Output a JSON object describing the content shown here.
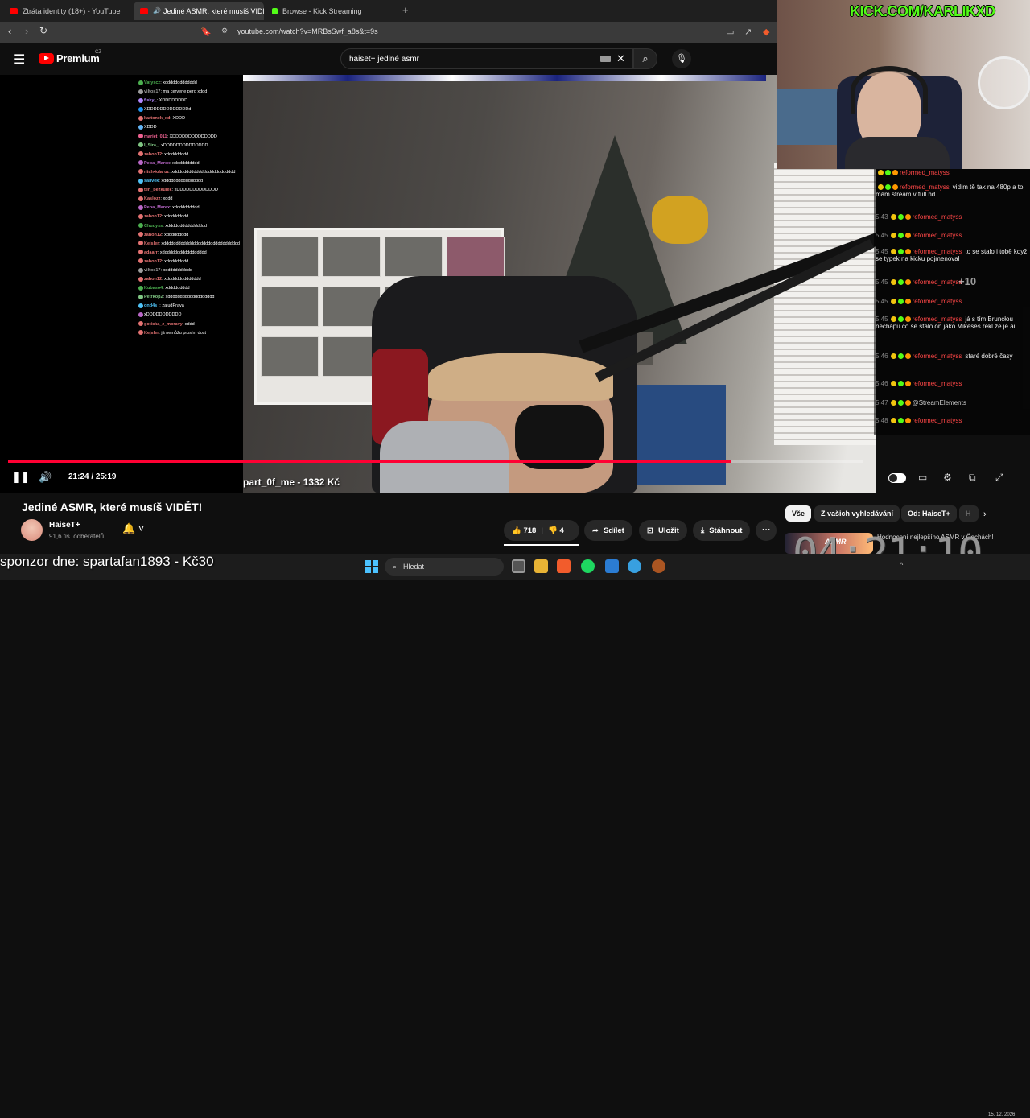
{
  "browser": {
    "tabs": [
      {
        "title": "Ztráta identity (18+) - YouTube",
        "active": false
      },
      {
        "title": "Jediné ASMR, které musíš VIDĚ",
        "active": true
      },
      {
        "title": "Browse - Kick Streaming",
        "active": false
      }
    ],
    "url": "youtube.com/watch?v=MRBsSwf_a8s&t=9s"
  },
  "youtube": {
    "logo": "Premium",
    "region": "CZ",
    "search_value": "haiset+ jediné asmr"
  },
  "overlay": {
    "kick_url": "KICK.COM/KARLIKXD",
    "donor_text": "part_0f_me - 1332 Kč",
    "sponsor": "sponzor dne: spartafan1893 - Kč30",
    "clock": "04:21:10"
  },
  "player": {
    "time": "21:24 / 25:19",
    "progress": 0.845
  },
  "left_chat": [
    {
      "name": "Vatyscz",
      "text": "xddddddddddddd",
      "color": "#4caf50"
    },
    {
      "name": "viltos17",
      "text": "ma cervene pero xddd",
      "color": "#9e9e9e"
    },
    {
      "name": "fisky_",
      "text": "XDDDDDDDD",
      "color": "#b388ff"
    },
    {
      "name": "",
      "text": "XDDDDDDDDDDDDDd",
      "color": "#2196f3"
    },
    {
      "name": "kartonek_xd",
      "text": "XDDD",
      "color": "#e57373"
    },
    {
      "name": "",
      "text": "XDDD",
      "color": "#64b5f6"
    },
    {
      "name": "mariet_011",
      "text": "XDDDDDDDDDDDDDD",
      "color": "#f06292"
    },
    {
      "name": "l_Sira_",
      "text": "xDDDDDDDDDDDDDD",
      "color": "#81c784"
    },
    {
      "name": "zahon12",
      "text": "xddddddddd",
      "color": "#e57373"
    },
    {
      "name": "Pepa_Marex",
      "text": "xdddddddddd",
      "color": "#ba68c8"
    },
    {
      "name": "ritch4olaruz",
      "text": "xddddddddddddddddddddddddd",
      "color": "#e57373"
    },
    {
      "name": "salivek",
      "text": "xdddddddddddddddd",
      "color": "#4fc3f7"
    },
    {
      "name": "ten_bezkulek",
      "text": "xDDDDDDDDDDDDD",
      "color": "#e57373"
    },
    {
      "name": "Kaslozz",
      "text": "xddd",
      "color": "#e57373"
    },
    {
      "name": "Pepa_Marex",
      "text": "xdddddddddd",
      "color": "#ba68c8"
    },
    {
      "name": "zahon12",
      "text": "xddddddddd",
      "color": "#e57373"
    },
    {
      "name": "Chudyss",
      "text": "xdddddddddddddddd",
      "color": "#4caf50"
    },
    {
      "name": "zahon12",
      "text": "xddddddddd",
      "color": "#e57373"
    },
    {
      "name": "Kejsler",
      "text": "xddddddddddddddddddddddddddddddd",
      "color": "#e57373"
    },
    {
      "name": "adaarr",
      "text": "xdddddddddddddddddd",
      "color": "#e57373"
    },
    {
      "name": "zahon12",
      "text": "xddddddddd",
      "color": "#e57373"
    },
    {
      "name": "viltos17",
      "text": "xddddddddddd",
      "color": "#9e9e9e"
    },
    {
      "name": "zahon12",
      "text": "xdddddddddddddd",
      "color": "#e57373"
    },
    {
      "name": "Kubaso4",
      "text": "xddddddddd",
      "color": "#4caf50"
    },
    {
      "name": "Petrkop2",
      "text": "xddddddddddddddddddd",
      "color": "#81c784"
    },
    {
      "name": "ond4s_",
      "text": "zaludPrava",
      "color": "#4fc3f7"
    },
    {
      "name": "",
      "text": "xDDDDDDDDDDD",
      "color": "#ba68c8"
    },
    {
      "name": "gotícka_z_moravy",
      "text": "xddd",
      "color": "#e57373"
    },
    {
      "name": "Kejsler",
      "text": "já nemůžu prosím dost",
      "color": "#e57373"
    }
  ],
  "right_chat": [
    {
      "time": "",
      "name": "reformed_matyss",
      "text": ""
    },
    {
      "time": "",
      "name": "reformed_matyss",
      "text": "vidím tě tak na 480p a to mám stream v full hd"
    },
    {
      "time": "5:43",
      "name": "reformed_matyss",
      "text": ""
    },
    {
      "time": "5:45",
      "name": "reformed_matyss",
      "text": ""
    },
    {
      "time": "5:45",
      "name": "reformed_matyss",
      "text": "to se stalo i tobě když se typek na kicku pojmenoval"
    },
    {
      "time": "5:45",
      "name": "reformed_matyss",
      "text": ""
    },
    {
      "time": "5:45",
      "name": "reformed_matyss",
      "text": ""
    },
    {
      "time": "5:45",
      "name": "reformed_matyss",
      "text": "já s tím Bruncłou nechápu co se stalo on jako Mikeses řekl že je ai"
    },
    {
      "time": "5:46",
      "name": "reformed_matyss",
      "text": "staré dobré časy"
    },
    {
      "time": "5:46",
      "name": "reformed_matyss",
      "text": ""
    },
    {
      "time": "5:47",
      "name": "@StreamElements",
      "text": ""
    },
    {
      "time": "5:48",
      "name": "reformed_matyss",
      "text": ""
    }
  ],
  "right_chat_extra": "+10",
  "video": {
    "title": "Jediné ASMR, které musíš VIDĚT!",
    "channel": "HaiseT+",
    "subscribers": "91,6 tis. odběratelů",
    "likes": "718",
    "dislikes": "4",
    "share": "Sdílet",
    "save": "Uložit",
    "download": "Stáhnout"
  },
  "chips": [
    "Vše",
    "Z vašich vyhledávání",
    "Od: HaiseT+",
    "H"
  ],
  "recommended_text": "Hodnocení nejlepšího ASMR v Čechách!",
  "recommended_badge": "ASMR",
  "taskbar": {
    "search": "Hledat",
    "date": "15. 12. 2026"
  },
  "colors": {
    "accent_red": "#ff0033",
    "kick_green": "#53fc18",
    "chat_name_red": "#ff4747"
  }
}
